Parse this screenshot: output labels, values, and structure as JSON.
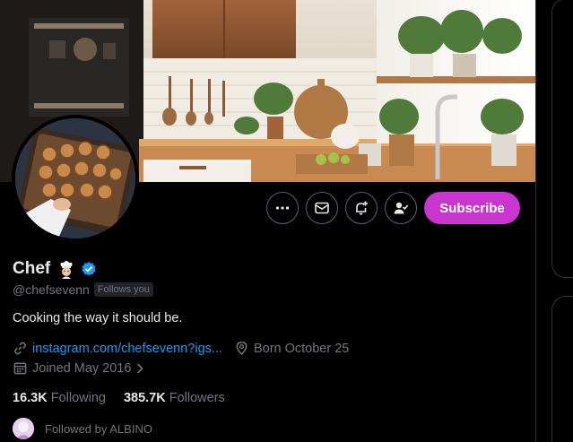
{
  "profile": {
    "name": "Chef",
    "handle": "@chefsevenn",
    "follows_you": "Follows you",
    "bio": "Cooking the way it should be.",
    "link": "instagram.com/chefsevenn?igs...",
    "born": "Born October 25",
    "joined": "Joined May 2016",
    "following_count": "16.3K",
    "following_label": "Following",
    "followers_count": "385.7K",
    "followers_label": "Followers",
    "followed_by": "Followed by ALBINO"
  },
  "actions": {
    "more_icon": "more-icon",
    "message_icon": "mail-icon",
    "notify_icon": "bell-plus-icon",
    "follow_icon": "person-check-icon",
    "subscribe_label": "Subscribe"
  },
  "colors": {
    "accent": "#1d9bf0",
    "subscribe": "#c936cf",
    "muted": "#71767b",
    "text": "#e7e9ea",
    "background": "#000000"
  }
}
